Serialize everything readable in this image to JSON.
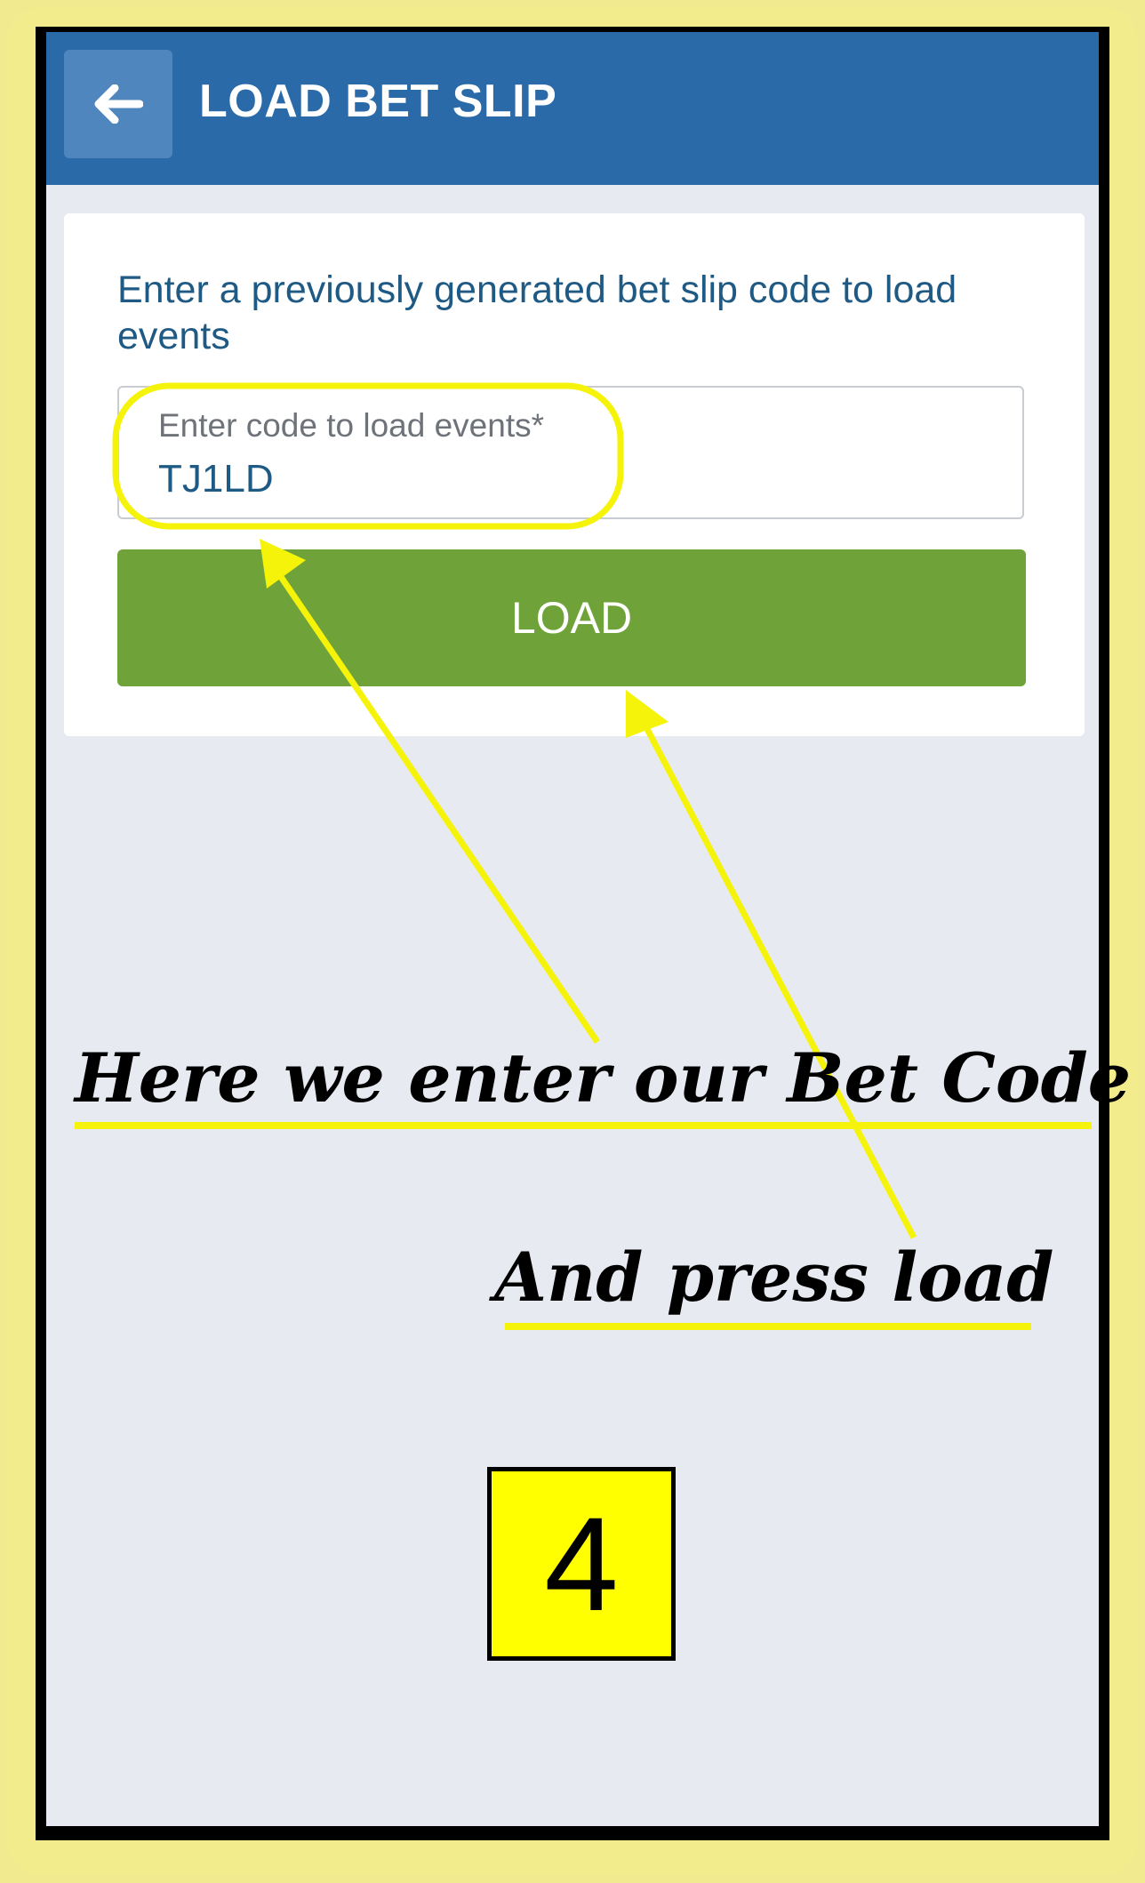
{
  "header": {
    "title": "LOAD BET SLIP",
    "back_icon": "arrow-left-icon"
  },
  "card": {
    "description": "Enter a previously generated bet slip code to load events",
    "code_field": {
      "label": "Enter code to load events*",
      "value": "TJ1LD"
    },
    "load_button_label": "LOAD"
  },
  "annotations": {
    "caption_enter": "Here we enter our Bet Code",
    "caption_load": "And press load",
    "step_number": "4"
  },
  "colors": {
    "app_bar": "#2b6aa8",
    "load_button": "#6fa33a",
    "highlight": "#ffff00",
    "frame": "#f3ec8c"
  }
}
